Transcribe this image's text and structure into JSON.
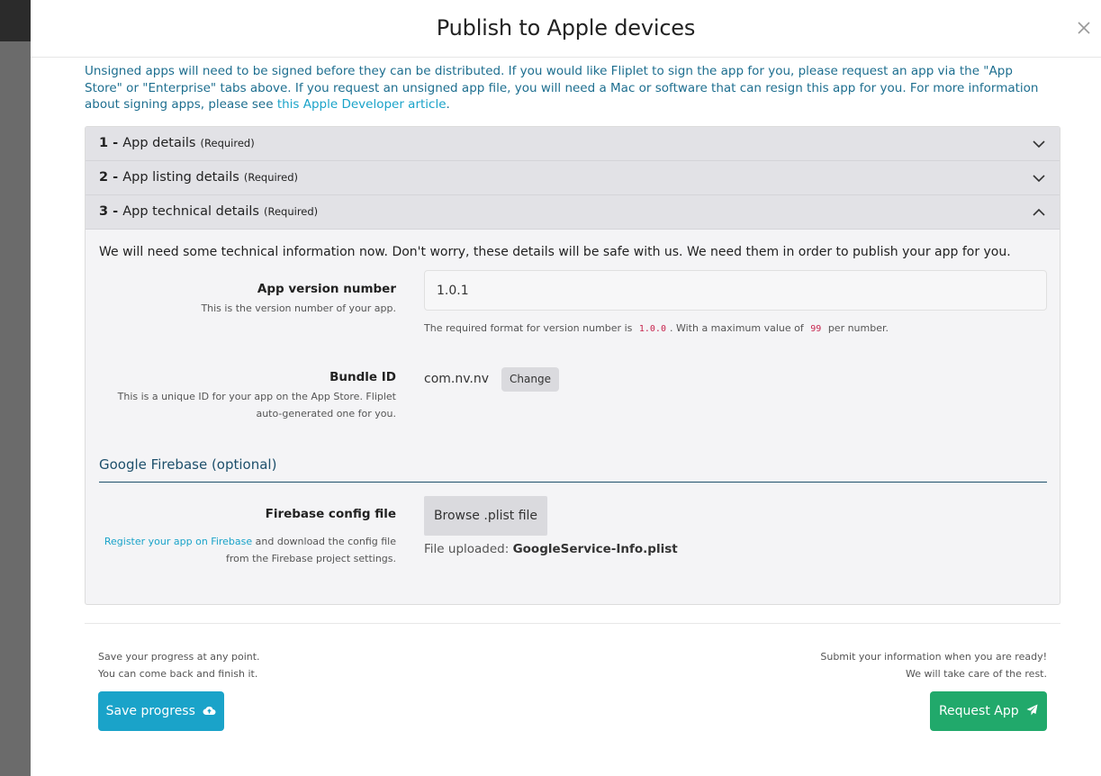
{
  "modal": {
    "title": "Publish to Apple devices",
    "close_icon": "close-icon"
  },
  "intro": {
    "text": "Unsigned apps will need to be signed before they can be distributed. If you would like Fliplet to sign the app for you, please request an app via the \"App Store\" or \"Enterprise\" tabs above. If you request an unsigned app file, you will need a Mac or software that can resign this app for you. For more information about signing apps, please see ",
    "link_text": "this Apple Developer article",
    "suffix": "."
  },
  "accordion": {
    "sections": [
      {
        "num": "1 -",
        "label": "App details",
        "req": "(Required)",
        "state": "collapsed",
        "icon": "chevron-down-icon"
      },
      {
        "num": "2 -",
        "label": "App listing details",
        "req": "(Required)",
        "state": "collapsed",
        "icon": "chevron-down-icon"
      },
      {
        "num": "3 -",
        "label": "App technical details",
        "req": "(Required)",
        "state": "expanded",
        "icon": "chevron-up-icon"
      }
    ],
    "body_intro": "We will need some technical information now. Don't worry, these details will be safe with us. We need them in order to publish your app for you."
  },
  "version": {
    "label": "App version number",
    "help": "This is the version number of your app.",
    "value": "1.0.1",
    "note_prefix": "The required format for version number is",
    "note_format": "1.0.0",
    "note_middle": ". With a maximum value of",
    "note_max": "99",
    "note_suffix": "per number."
  },
  "bundle": {
    "label": "Bundle ID",
    "help_line1": "This is a unique ID for your app on the App Store. Fliplet",
    "help_line2": "auto-generated one for you.",
    "value": "com.nv.nv",
    "change_label": "Change"
  },
  "firebase": {
    "section_title": "Google Firebase (optional)",
    "label": "Firebase config file",
    "link_text": "Register your app on Firebase",
    "help_rest": " and download the config file",
    "help_line2": "from the Firebase project settings.",
    "browse_label": "Browse .plist file",
    "uploaded_prefix": "File uploaded: ",
    "uploaded_file": "GoogleService-Info.plist"
  },
  "footer": {
    "left_line1": "Save your progress at any point.",
    "left_line2": "You can come back and finish it.",
    "right_line1": "Submit your information when you are ready!",
    "right_line2": "We will take care of the rest.",
    "save_label": "Save progress",
    "save_icon": "cloud-upload-icon",
    "request_label": "Request App",
    "request_icon": "paper-plane-icon"
  },
  "colors": {
    "accent": "#1aa3c9",
    "success": "#21a96b",
    "intro_text": "#1d6e8f",
    "section_title": "#1d4f6b"
  }
}
